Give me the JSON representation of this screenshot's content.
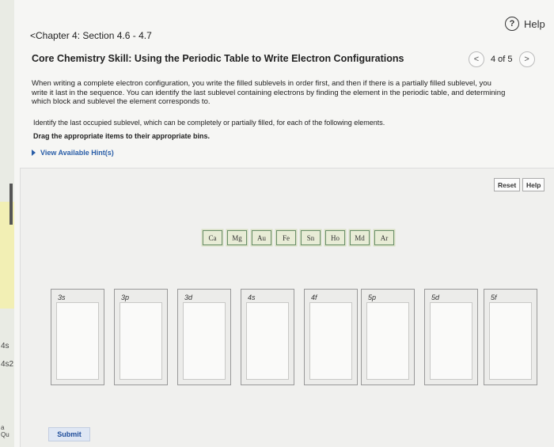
{
  "left_strip": {
    "text1": "4s",
    "text2": "4s2",
    "text3": "a Qu"
  },
  "help_label": "Help",
  "chapter": "<Chapter 4: Section 4.6 - 4.7",
  "title": "Core Chemistry Skill: Using the Periodic Table to Write Electron Configurations",
  "pager": {
    "prev": "<",
    "label": "4 of 5",
    "next": ">"
  },
  "intro": "When writing a complete electron configuration, you write the filled sublevels in order first, and then if there is a partially filled sublevel, you write it last in the sequence. You can identify the last sublevel containing electrons by finding the element in the periodic table, and determining which block and sublevel the element corresponds to.",
  "identify": "Identify the last occupied sublevel, which can be completely or partially filled, for each of the following elements.",
  "drag": "Drag the appropriate items to their appropriate bins.",
  "hints": "View Available Hint(s)",
  "buttons": {
    "reset": "Reset",
    "help": "Help",
    "submit": "Submit"
  },
  "items": [
    "Ca",
    "Mg",
    "Au",
    "Fe",
    "Sn",
    "Ho",
    "Md",
    "Ar"
  ],
  "bins": [
    "3s",
    "3p",
    "3d",
    "4s",
    "4f",
    "5p",
    "5d",
    "5f"
  ]
}
